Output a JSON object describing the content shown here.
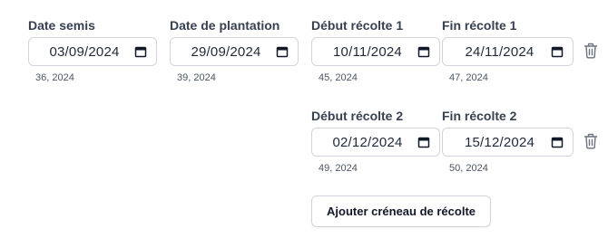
{
  "fields": {
    "sowing": {
      "label": "Date semis",
      "value": "03/09/2024",
      "week": "36, 2024"
    },
    "planting": {
      "label": "Date de plantation",
      "value": "29/09/2024",
      "week": "39, 2024"
    }
  },
  "harvest_slots": [
    {
      "start": {
        "label": "Début récolte 1",
        "value": "10/11/2024",
        "week": "45, 2024"
      },
      "end": {
        "label": "Fin récolte 1",
        "value": "24/11/2024",
        "week": "47, 2024"
      }
    },
    {
      "start": {
        "label": "Début récolte 2",
        "value": "02/12/2024",
        "week": "49, 2024"
      },
      "end": {
        "label": "Fin récolte 2",
        "value": "15/12/2024",
        "week": "50, 2024"
      }
    }
  ],
  "actions": {
    "add_slot_label": "Ajouter créneau de récolte"
  },
  "icons": {
    "calendar": "calendar-icon",
    "delete": "trash-icon"
  },
  "colors": {
    "border": "#d1d5db",
    "label": "#374151",
    "text": "#1f2937",
    "muted": "#4b5563",
    "icon": "#6b7280"
  }
}
